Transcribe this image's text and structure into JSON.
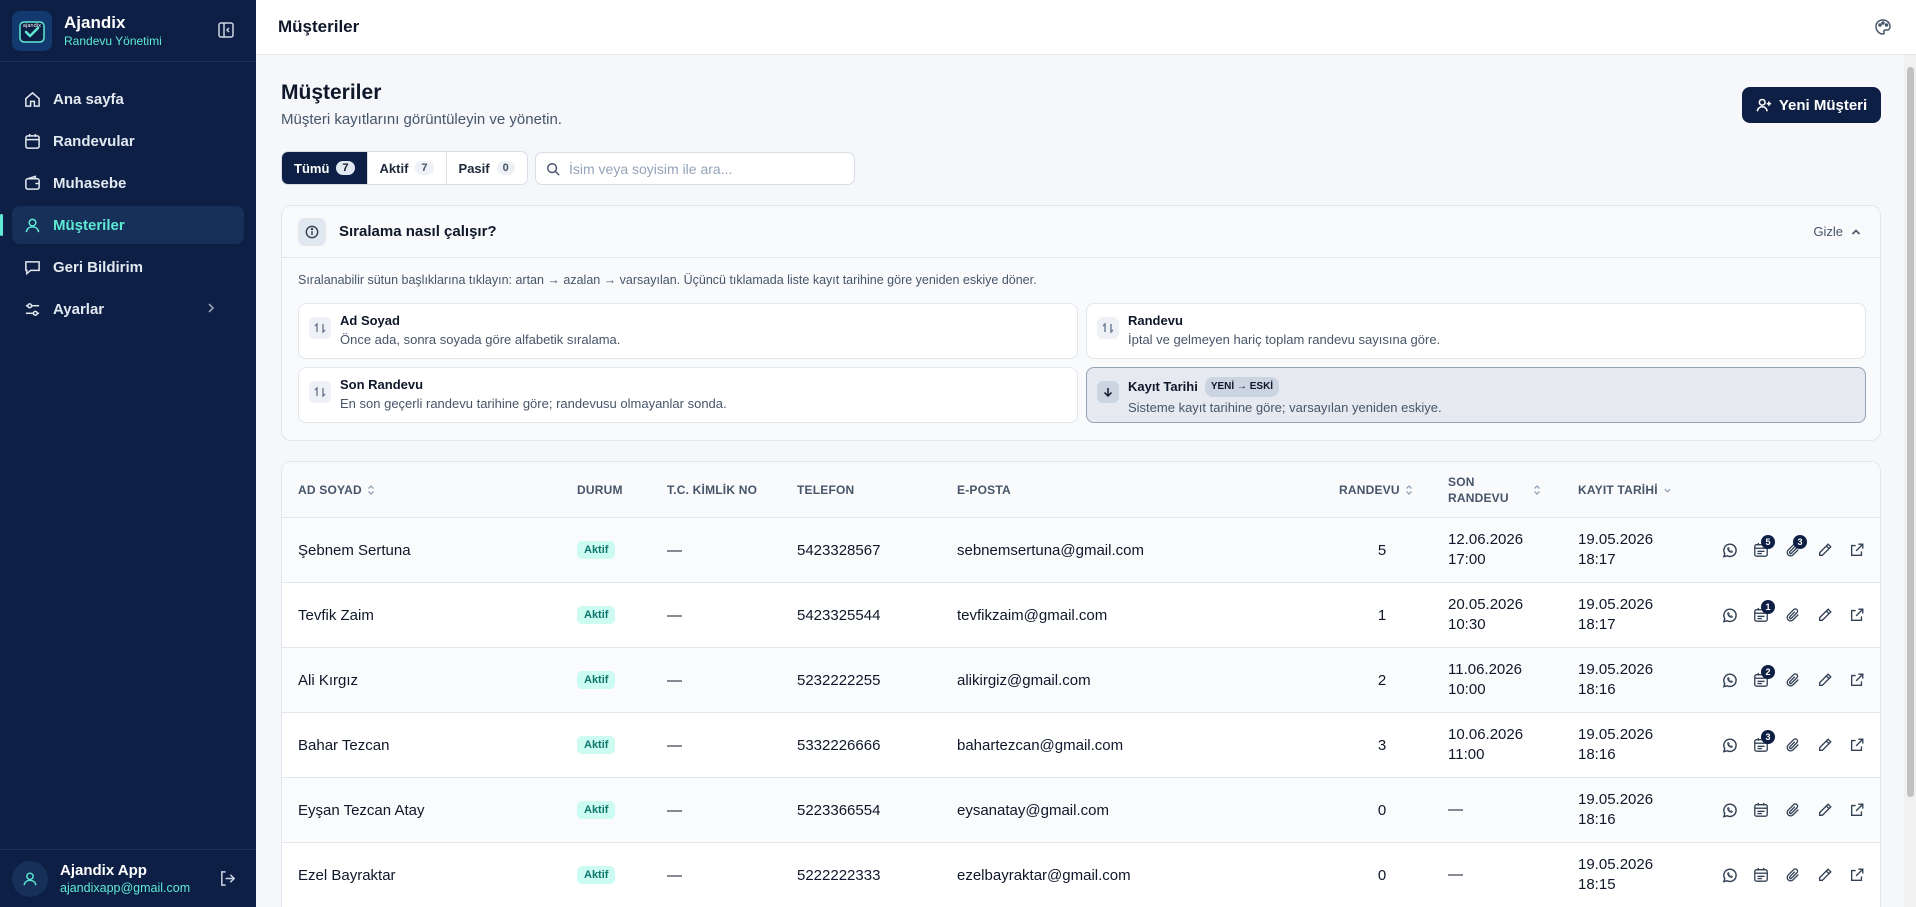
{
  "brand": {
    "name": "Ajandix",
    "tagline": "Randevu Yönetimi",
    "logo_text": "ajandix"
  },
  "nav": [
    {
      "label": "Ana sayfa",
      "icon": "home-icon"
    },
    {
      "label": "Randevular",
      "icon": "calendar-icon"
    },
    {
      "label": "Muhasebe",
      "icon": "wallet-icon"
    },
    {
      "label": "Müşteriler",
      "icon": "user-icon",
      "active": true
    },
    {
      "label": "Geri Bildirim",
      "icon": "message-icon"
    },
    {
      "label": "Ayarlar",
      "icon": "sliders-icon"
    }
  ],
  "user": {
    "name": "Ajandix App",
    "email": "ajandixapp@gmail.com"
  },
  "topbar": {
    "title": "Müşteriler"
  },
  "page": {
    "title": "Müşteriler",
    "subtitle": "Müşteri kayıtlarını görüntüleyin ve yönetin.",
    "new_button": "Yeni Müşteri"
  },
  "filters": [
    {
      "label": "Tümü",
      "count": "7",
      "active": true
    },
    {
      "label": "Aktif",
      "count": "7"
    },
    {
      "label": "Pasif",
      "count": "0"
    }
  ],
  "search": {
    "placeholder": "İsim veya soyisim ile ara...",
    "value": ""
  },
  "info": {
    "title": "Sıralama nasıl çalışır?",
    "hide_label": "Gizle",
    "description": "Sıralanabilir sütun başlıklarına tıklayın: artan → azalan → varsayılan. Üçüncü tıklamada liste kayıt tarihine göre yeniden eskiye döner.",
    "cards": [
      {
        "title": "Ad Soyad",
        "desc": "Önce ada, sonra soyada göre alfabetik sıralama."
      },
      {
        "title": "Randevu",
        "desc": "İptal ve gelmeyen hariç toplam randevu sayısına göre."
      },
      {
        "title": "Son Randevu",
        "desc": "En son geçerli randevu tarihine göre; randevusu olmayanlar sonda."
      },
      {
        "title": "Kayıt Tarihi",
        "badge": "YENİ → ESKİ",
        "desc": "Sisteme kayıt tarihine göre; varsayılan yeniden eskiye."
      }
    ]
  },
  "table": {
    "headers": {
      "name": "AD SOYAD",
      "status": "DURUM",
      "tc": "T.C. KİMLİK NO",
      "phone": "TELEFON",
      "email": "E-POSTA",
      "appt": "RANDEVU",
      "last_a": "SON",
      "last_b": "RANDEVU",
      "reg": "KAYIT TARİHİ"
    },
    "rows": [
      {
        "name": "Şebnem Sertuna",
        "status": "Aktif",
        "tc": "—",
        "phone": "5423328567",
        "email": "sebnemsertuna@gmail.com",
        "appt": "5",
        "last_date": "12.06.2026",
        "last_time": "17:00",
        "reg_date": "19.05.2026",
        "reg_time": "18:17",
        "cal_badge": "5",
        "att_badge": "3"
      },
      {
        "name": "Tevfik Zaim",
        "status": "Aktif",
        "tc": "—",
        "phone": "5423325544",
        "email": "tevfikzaim@gmail.com",
        "appt": "1",
        "last_date": "20.05.2026",
        "last_time": "10:30",
        "reg_date": "19.05.2026",
        "reg_time": "18:17",
        "cal_badge": "1",
        "att_badge": ""
      },
      {
        "name": "Ali Kırgız",
        "status": "Aktif",
        "tc": "—",
        "phone": "5232222255",
        "email": "alikirgiz@gmail.com",
        "appt": "2",
        "last_date": "11.06.2026",
        "last_time": "10:00",
        "reg_date": "19.05.2026",
        "reg_time": "18:16",
        "cal_badge": "2",
        "att_badge": ""
      },
      {
        "name": "Bahar Tezcan",
        "status": "Aktif",
        "tc": "—",
        "phone": "5332226666",
        "email": "bahartezcan@gmail.com",
        "appt": "3",
        "last_date": "10.06.2026",
        "last_time": "11:00",
        "reg_date": "19.05.2026",
        "reg_time": "18:16",
        "cal_badge": "3",
        "att_badge": ""
      },
      {
        "name": "Eyşan Tezcan Atay",
        "status": "Aktif",
        "tc": "—",
        "phone": "5223366554",
        "email": "eysanatay@gmail.com",
        "appt": "0",
        "last_date": "—",
        "last_time": "",
        "reg_date": "19.05.2026",
        "reg_time": "18:16",
        "cal_badge": "",
        "att_badge": ""
      },
      {
        "name": "Ezel Bayraktar",
        "status": "Aktif",
        "tc": "—",
        "phone": "5222222333",
        "email": "ezelbayraktar@gmail.com",
        "appt": "0",
        "last_date": "—",
        "last_time": "",
        "reg_date": "19.05.2026",
        "reg_time": "18:15",
        "cal_badge": "",
        "att_badge": ""
      }
    ]
  },
  "colors": {
    "sidebar": "#0d1f44",
    "accent": "#5eead4",
    "status_bg": "#ccfbf1",
    "status_fg": "#0f766e"
  }
}
